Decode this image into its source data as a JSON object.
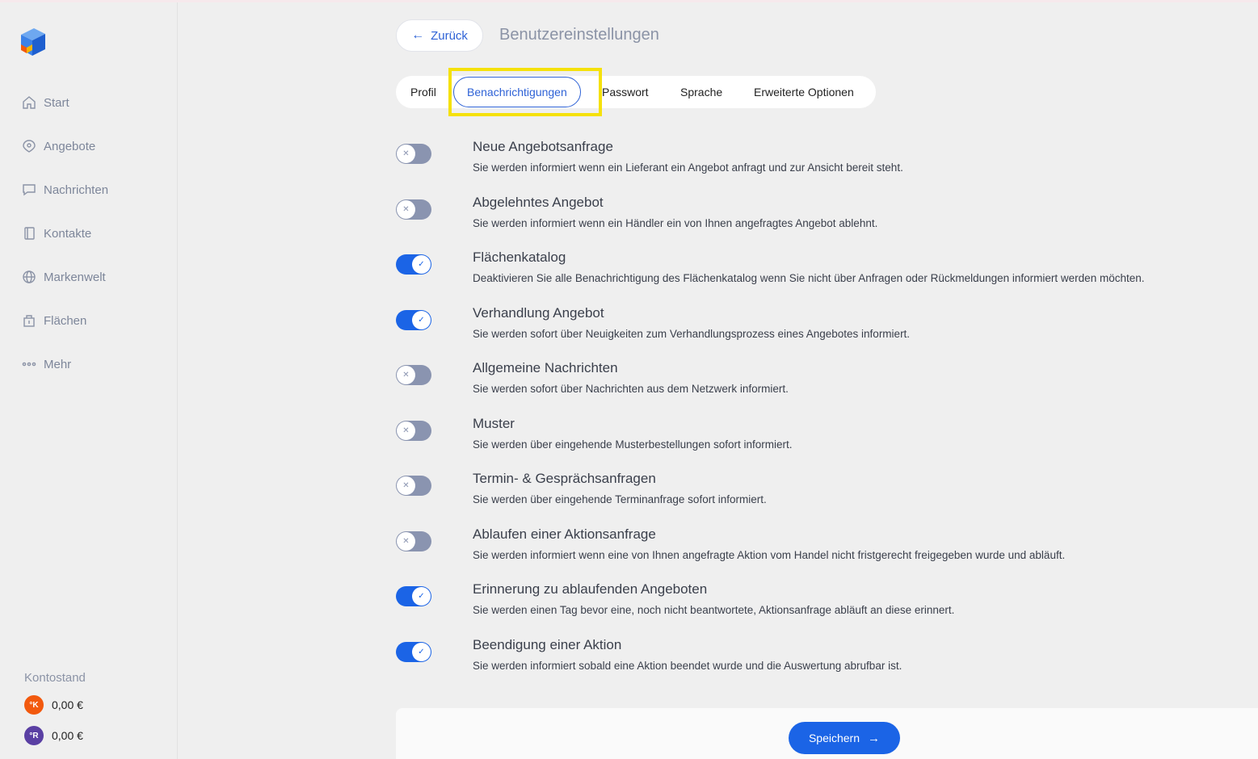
{
  "header": {
    "back_label": "Zurück",
    "title": "Benutzereinstellungen"
  },
  "sidebar": {
    "items": [
      {
        "label": "Start",
        "icon": "home-icon"
      },
      {
        "label": "Angebote",
        "icon": "tag-icon"
      },
      {
        "label": "Nachrichten",
        "icon": "chat-icon"
      },
      {
        "label": "Kontakte",
        "icon": "contacts-book-icon"
      },
      {
        "label": "Markenwelt",
        "icon": "globe-icon"
      },
      {
        "label": "Flächen",
        "icon": "store-icon"
      },
      {
        "label": "Mehr",
        "icon": "more-dots-icon"
      }
    ],
    "balance_title": "Kontostand",
    "balances": [
      {
        "coin": "°K",
        "value": "0,00 €",
        "color": "#f2590e"
      },
      {
        "coin": "°R",
        "value": "0,00 €",
        "color": "#5a3fa3"
      }
    ]
  },
  "tabs": [
    {
      "label": "Profil"
    },
    {
      "label": "Benachrichtigungen",
      "active": true
    },
    {
      "label": "Passwort"
    },
    {
      "label": "Sprache"
    },
    {
      "label": "Erweiterte Optionen"
    }
  ],
  "settings": [
    {
      "title": "Neue Angebotsanfrage",
      "desc": "Sie werden informiert wenn ein Lieferant ein Angebot anfragt und zur Ansicht bereit steht.",
      "on": false
    },
    {
      "title": "Abgelehntes Angebot",
      "desc": "Sie werden informiert wenn ein Händler ein von Ihnen angefragtes Angebot ablehnt.",
      "on": false
    },
    {
      "title": "Flächenkatalog",
      "desc": "Deaktivieren Sie alle Benachrichtigung des Flächenkatalog wenn Sie nicht über Anfragen oder Rückmeldungen informiert werden möchten.",
      "on": true
    },
    {
      "title": "Verhandlung Angebot",
      "desc": "Sie werden sofort über Neuigkeiten zum Verhandlungsprozess eines Angebotes informiert.",
      "on": true
    },
    {
      "title": "Allgemeine Nachrichten",
      "desc": "Sie werden sofort über Nachrichten aus dem Netzwerk informiert.",
      "on": false
    },
    {
      "title": "Muster",
      "desc": "Sie werden über eingehende Musterbestellungen sofort informiert.",
      "on": false
    },
    {
      "title": "Termin- & Gesprächsanfragen",
      "desc": "Sie werden über eingehende Terminanfrage sofort informiert.",
      "on": false
    },
    {
      "title": "Ablaufen einer Aktionsanfrage",
      "desc": "Sie werden informiert wenn eine von Ihnen angefragte Aktion vom Handel nicht fristgerecht freigegeben wurde und abläuft.",
      "on": false
    },
    {
      "title": "Erinnerung zu ablaufenden Angeboten",
      "desc": "Sie werden einen Tag bevor eine, noch nicht beantwortete, Aktionsanfrage abläuft an diese erinnert.",
      "on": true
    },
    {
      "title": "Beendigung einer Aktion",
      "desc": "Sie werden informiert sobald eine Aktion beendet wurde und die Auswertung abrufbar ist.",
      "on": true
    }
  ],
  "footer": {
    "save_label": "Speichern"
  },
  "colors": {
    "accent": "#1b64e6",
    "toggle_off": "#8a94b0",
    "highlight": "#f5e10a"
  }
}
